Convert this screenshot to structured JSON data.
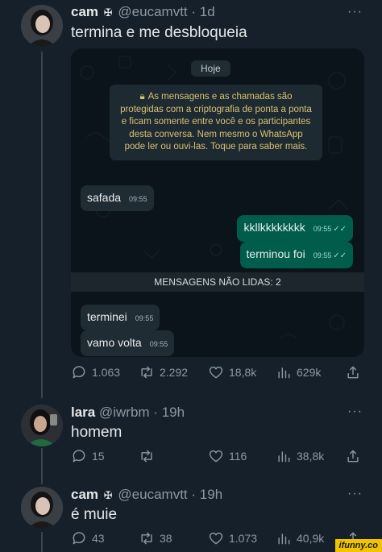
{
  "tweets": [
    {
      "name": "cam",
      "badge": "✠",
      "handle": "@eucamvtt",
      "time": "1d",
      "text": "termina e me desbloqueia",
      "stats": {
        "replies": "1.063",
        "retweets": "2.292",
        "likes": "18,8k",
        "views": "629k"
      }
    },
    {
      "name": "lara",
      "handle": "@iwrbm",
      "time": "19h",
      "text": "homem",
      "stats": {
        "replies": "15",
        "retweets": "",
        "likes": "116",
        "views": "38,8k"
      }
    },
    {
      "name": "cam",
      "badge": "✠",
      "handle": "@eucamvtt",
      "time": "19h",
      "text": "é muie",
      "stats": {
        "replies": "43",
        "retweets": "38",
        "likes": "1.073",
        "views": "40,9k"
      }
    }
  ],
  "whatsapp": {
    "day_label": "Hoje",
    "encryption_notice": "As mensagens e as chamadas são protegidas com a criptografia de ponta a ponta e ficam somente entre você e os participantes desta conversa. Nem mesmo o WhatsApp pode ler ou ouvi-las. Toque para saber mais.",
    "unread_label": "MENSAGENS NÃO LIDAS: 2",
    "messages": [
      {
        "dir": "in",
        "text": "safada",
        "time": "09:55"
      },
      {
        "dir": "out",
        "text": "kkllkkkkkkkk",
        "time": "09:55"
      },
      {
        "dir": "out",
        "text": "terminou foi",
        "time": "09:55"
      },
      {
        "dir": "in",
        "text": "terminei",
        "time": "09:55"
      },
      {
        "dir": "in",
        "text": "vamo volta",
        "time": "09:55"
      }
    ]
  },
  "watermark": "ifunny.co",
  "colors": {
    "background": "#15202b",
    "muted": "#8b98a5",
    "wa_out": "#005c4b",
    "wa_in": "#202c33",
    "wa_notice": "#d8c074"
  }
}
